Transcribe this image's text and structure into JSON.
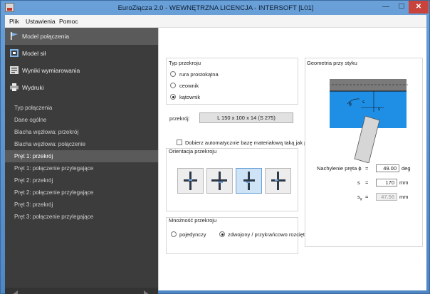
{
  "window": {
    "title": "EuroZłącza 2.0 - WEWNĘTRZNA LICENCJA - INTERSOFT [L01]",
    "minimize": "—",
    "maximize": "☐",
    "close": "✕"
  },
  "menu": {
    "file": "Plik",
    "settings": "Ustawienia",
    "help": "Pomoc"
  },
  "sidebar": {
    "nav": [
      "Model połączenia",
      "Model sił",
      "Wyniki wymiarowania",
      "Wydruki"
    ],
    "sub": [
      "Typ połączenia",
      "Dane ogólne",
      "Blacha węzłowa: przekrój",
      "Blacha węzłowa: połączenie",
      "Pręt 1: przekrój",
      "Pręt 1: połączenie przylegające",
      "Pręt 2: przekrój",
      "Pręt 2: połączenie przylegające",
      "Pręt 3: przekrój",
      "Pręt 3: połączenie przylegające"
    ],
    "active_sub": "Pręt 1: przekrój"
  },
  "section_type": {
    "title": "Typ przekroju",
    "options": [
      "rura prostokątna",
      "ceownik",
      "kątownik"
    ],
    "selected": "kątownik"
  },
  "section": {
    "label": "przekrój:",
    "value": "L 150 x 100 x 14 (S 275)"
  },
  "auto_material": {
    "label": "Dobierz automatycznie bazę materiałową taką jak pasa",
    "checked": false
  },
  "orientation": {
    "title": "Orientacja przekroju",
    "selected_index": 2
  },
  "multiplicity": {
    "title": "Mnożność przekroju",
    "options": [
      "pojedynczy",
      "zdwojony / przykrańcowo rozcięty"
    ],
    "selected": "zdwojony / przykrańcowo rozcięty"
  },
  "geometry": {
    "title": "Geometria przy styku",
    "fields": [
      {
        "label": "Nachylenie pręta ϕ",
        "eq": "=",
        "value": "49.00",
        "unit": "deg"
      },
      {
        "label": "s",
        "eq": "=",
        "value": "170",
        "unit": "mm"
      },
      {
        "label": "s",
        "sub": "x",
        "eq": "=",
        "value": "47.56",
        "unit": "mm"
      }
    ]
  }
}
